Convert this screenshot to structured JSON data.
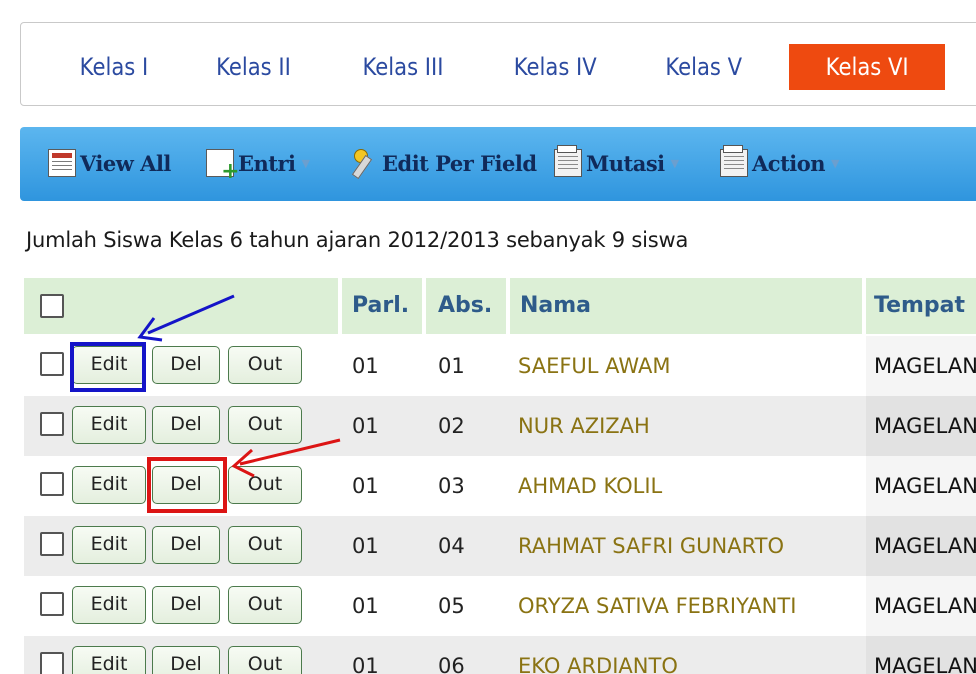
{
  "tabs": [
    "Kelas I",
    "Kelas II",
    "Kelas III",
    "Kelas IV",
    "Kelas V",
    "Kelas VI"
  ],
  "active_tab": "Kelas VI",
  "toolbar": {
    "view_all": "View All",
    "entri": "Entri",
    "edit_per_field": "Edit Per Field",
    "mutasi": "Mutasi",
    "action": "Action"
  },
  "summary": "Jumlah Siswa Kelas 6 tahun ajaran 2012/2013 sebanyak 9 siswa",
  "table": {
    "headers": {
      "parl": "Parl.",
      "abs": "Abs.",
      "nama": "Nama",
      "tempat": "Tempat"
    },
    "button_labels": {
      "edit": "Edit",
      "del": "Del",
      "out": "Out"
    },
    "rows": [
      {
        "parl": "01",
        "abs": "01",
        "nama": "SAEFUL AWAM",
        "tempat": "MAGELAN"
      },
      {
        "parl": "01",
        "abs": "02",
        "nama": "NUR AZIZAH",
        "tempat": "MAGELAN"
      },
      {
        "parl": "01",
        "abs": "03",
        "nama": "AHMAD KOLIL",
        "tempat": "MAGELAN"
      },
      {
        "parl": "01",
        "abs": "04",
        "nama": "RAHMAT SAFRI GUNARTO",
        "tempat": "MAGELAN"
      },
      {
        "parl": "01",
        "abs": "05",
        "nama": "ORYZA SATIVA FEBRIYANTI",
        "tempat": "MAGELAN"
      },
      {
        "parl": "01",
        "abs": "06",
        "nama": "EKO ARDIANTO",
        "tempat": "MAGELAN"
      }
    ]
  },
  "colors": {
    "active_tab": "#ee4a10",
    "toolbar": "#3fa3e6",
    "header_bg": "#dcefd6",
    "highlight_edit": "#1414c8",
    "highlight_del": "#dc1414"
  }
}
